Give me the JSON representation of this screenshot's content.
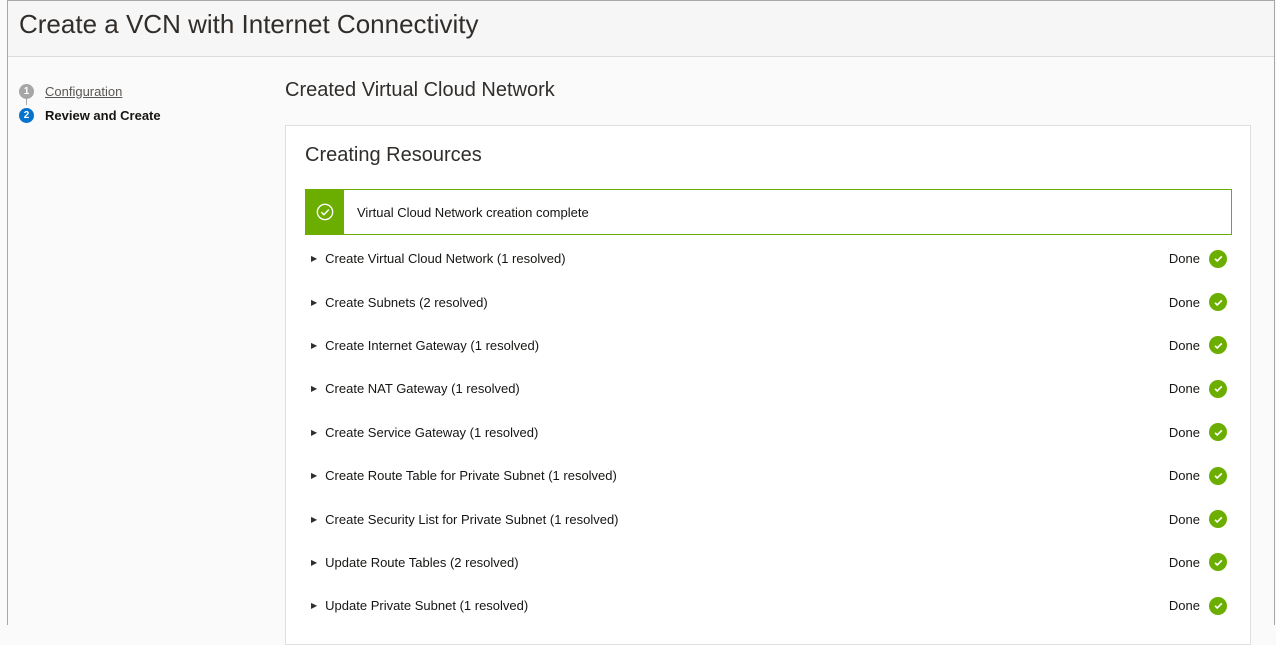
{
  "window": {
    "title": "Create a VCN with Internet Connectivity"
  },
  "steps": [
    {
      "number": "1",
      "label": "Configuration",
      "state": "done"
    },
    {
      "number": "2",
      "label": "Review and Create",
      "state": "active"
    }
  ],
  "main": {
    "title": "Created Virtual Cloud Network",
    "panel_title": "Creating Resources",
    "alert": {
      "message": "Virtual Cloud Network creation complete",
      "icon": "check-circle-icon",
      "color": "#6cae00"
    },
    "tasks": [
      {
        "label": "Create Virtual Cloud Network (1 resolved)",
        "status": "Done"
      },
      {
        "label": "Create Subnets (2 resolved)",
        "status": "Done"
      },
      {
        "label": "Create Internet Gateway (1 resolved)",
        "status": "Done"
      },
      {
        "label": "Create NAT Gateway (1 resolved)",
        "status": "Done"
      },
      {
        "label": "Create Service Gateway (1 resolved)",
        "status": "Done"
      },
      {
        "label": "Create Route Table for Private Subnet (1 resolved)",
        "status": "Done"
      },
      {
        "label": "Create Security List for Private Subnet (1 resolved)",
        "status": "Done"
      },
      {
        "label": "Update Route Tables (2 resolved)",
        "status": "Done"
      },
      {
        "label": "Update Private Subnet (1 resolved)",
        "status": "Done"
      }
    ]
  }
}
